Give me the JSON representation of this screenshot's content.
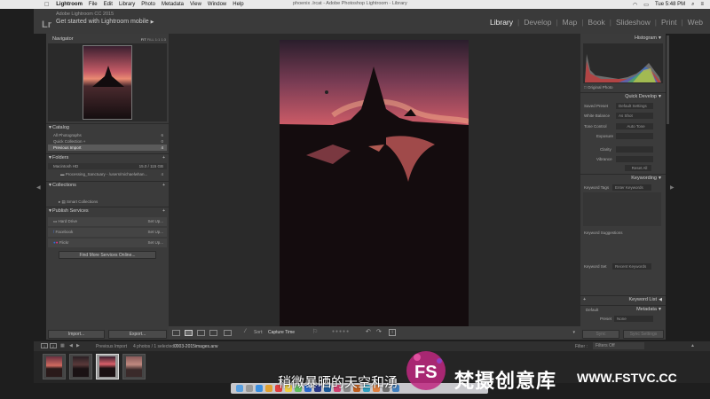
{
  "menubar": {
    "apple": "",
    "items": [
      "Lightroom",
      "File",
      "Edit",
      "Library",
      "Photo",
      "Metadata",
      "View",
      "Window",
      "Help"
    ],
    "window_title": "phoenix .lrcat - Adobe Photoshop Lightroom - Library",
    "clock": "Tue 5:48 PM"
  },
  "header": {
    "logo": "Lr",
    "product": "Adobe Lightroom CC 2015",
    "mobile": "Get started with Lightroom mobile",
    "modules": [
      "Library",
      "Develop",
      "Map",
      "Book",
      "Slideshow",
      "Print",
      "Web"
    ],
    "active_module": "Library"
  },
  "left_panel": {
    "navigator": {
      "title": "Navigator",
      "zoom": [
        "FIT",
        "FILL",
        "1:1",
        "1:3"
      ]
    },
    "catalog": {
      "title": "Catalog",
      "items": [
        {
          "label": "All Photographs",
          "count": "6"
        },
        {
          "label": "Quick Collection +",
          "count": "0"
        },
        {
          "label": "Previous Import",
          "count": "4"
        }
      ]
    },
    "folders": {
      "title": "Folders",
      "disk": {
        "label": "Macintosh HD",
        "count": "15.0 / 115 GB"
      },
      "folder": {
        "label": "Processing_Sanctuary - /users/michaelwhan...",
        "count": "4"
      }
    },
    "collections": {
      "title": "Collections",
      "items": [
        {
          "label": "Smart Collections"
        }
      ]
    },
    "publish": {
      "title": "Publish Services",
      "items": [
        {
          "label": "Hard Drive",
          "action": "Set Up..."
        },
        {
          "label": "Facebook",
          "action": "Set Up..."
        },
        {
          "label": "Flickr",
          "action": "Set Up..."
        }
      ],
      "find_more": "Find More Services Online..."
    },
    "import_button": "Import...",
    "export_button": "Export..."
  },
  "right_panel": {
    "histogram": {
      "title": "Histogram",
      "original_photo": "Original Photo"
    },
    "quick_develop": {
      "title": "Quick Develop",
      "saved_preset": {
        "label": "Saved Preset",
        "value": "Default Settings"
      },
      "white_balance": {
        "label": "White Balance",
        "value": "As Shot"
      },
      "tone_control": {
        "label": "Tone Control",
        "value": "Auto Tone"
      },
      "exposure": "Exposure",
      "clarity": "Clarity",
      "vibrance": "Vibrance",
      "reset_all": "Reset All"
    },
    "keywording": {
      "title": "Keywording",
      "keyword_tags": {
        "label": "Keyword Tags",
        "value": "Enter Keywords"
      },
      "suggestions": "Keyword Suggestions",
      "keyword_set": {
        "label": "Keyword Set",
        "value": "Recent Keywords"
      }
    },
    "keyword_list": {
      "title": "Keyword List"
    },
    "metadata": {
      "title": "Metadata",
      "preset_selector": "Default",
      "preset_label": "Preset",
      "preset_value": "None"
    },
    "sync": "Sync",
    "sync_settings": "Sync Settings"
  },
  "toolbar": {
    "sort_label": "Sort:",
    "sort_value": "Capture Time"
  },
  "filmbar": {
    "page1": "1",
    "page2": "2",
    "source": "Previous Import",
    "info": "4 photos / 1 selected /",
    "filename": "0003-2015images.arw",
    "filter_label": "Filter :",
    "filter_value": "Filters Off"
  },
  "subtitle": "稍微暴晒的天空和湧",
  "watermark": {
    "logo": "FS",
    "text": "梵摄创意库",
    "url": "WWW.FSTVC.CC"
  },
  "colors": {
    "accent": "#e0406a",
    "panel": "#3b3b3b",
    "header": "#3a3a3a"
  }
}
